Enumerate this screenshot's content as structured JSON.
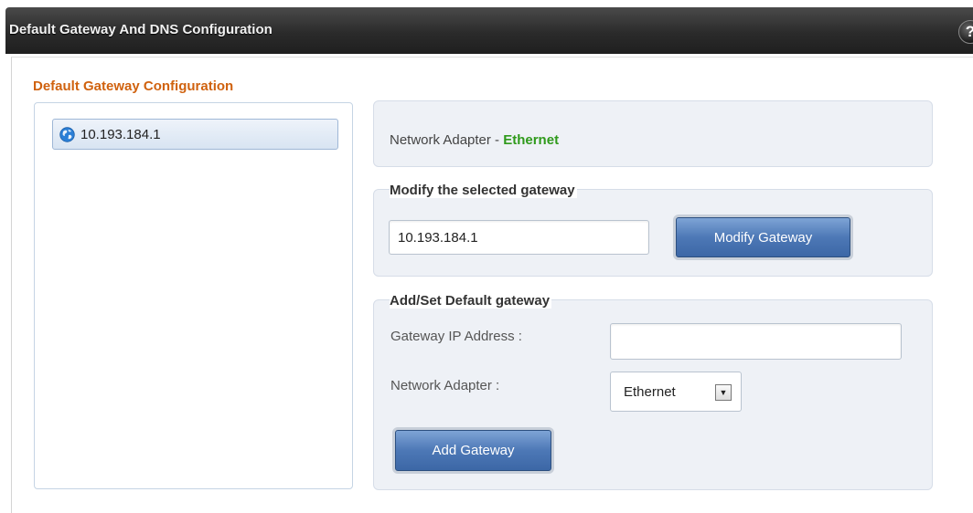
{
  "header": {
    "title": "Default Gateway And DNS Configuration",
    "help_label": "?"
  },
  "gateway_config": {
    "section_title": "Default Gateway Configuration",
    "gateways": [
      {
        "address": "10.193.184.1",
        "icon": "globe-icon",
        "selected": true
      }
    ]
  },
  "adapter_info": {
    "prefix": "Network Adapter - ",
    "adapter_name": "Ethernet",
    "adapter_color": "#2f9a1b"
  },
  "modify": {
    "legend": "Modify the selected gateway",
    "value": "10.193.184.1",
    "button_label": "Modify Gateway"
  },
  "add": {
    "legend": "Add/Set Default gateway",
    "ip_label": "Gateway IP Address :",
    "ip_value": "",
    "adapter_label": "Network Adapter :",
    "adapter_selected": "Ethernet",
    "button_label": "Add Gateway"
  },
  "colors": {
    "section_title": "#d0620f",
    "button": "#4d78b6"
  }
}
